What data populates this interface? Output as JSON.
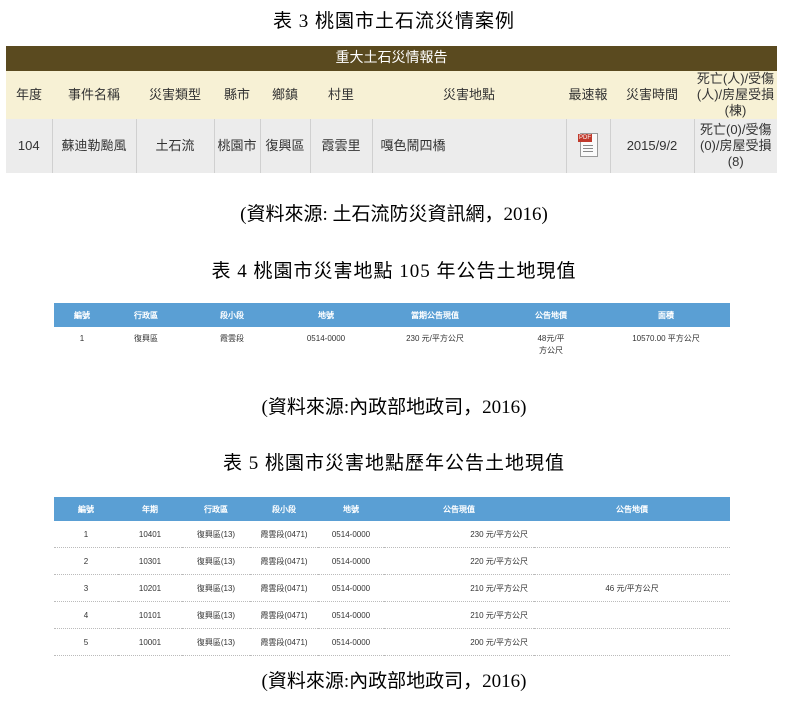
{
  "table3": {
    "caption": "表 3 桃園市土石流災情案例",
    "banner": "重大土石災情報告",
    "headers": [
      "年度",
      "事件名稱",
      "災害類型",
      "縣市",
      "鄉鎮",
      "村里",
      "災害地點",
      "最速報",
      "災害時間",
      "死亡(人)/受傷(人)/房屋受損(棟)"
    ],
    "row": {
      "year": "104",
      "event": "蘇迪勒颱風",
      "type": "土石流",
      "city": "桃園市",
      "town": "復興區",
      "village": "霞雲里",
      "location": "嘎色鬧四橋",
      "report_icon": "pdf-icon",
      "time": "2015/9/2",
      "casualties": "死亡(0)/受傷(0)/房屋受損(8)"
    },
    "source": "(資料來源: 土石流防災資訊網，2016)"
  },
  "table4": {
    "caption": "表 4 桃園市災害地點 105 年公告土地現值",
    "headers": [
      "編號",
      "行政區",
      "段小段",
      "地號",
      "當期公告現值",
      "公告地價",
      "面積"
    ],
    "row": {
      "no": "1",
      "district": "復興區",
      "section": "霞雲段",
      "lot": "0514-0000",
      "current_value": "230 元/平方公尺",
      "land_price": "48元/平方公尺",
      "area": "10570.00 平方公尺"
    },
    "source": "(資料來源:內政部地政司，2016)"
  },
  "table5": {
    "caption": "表 5 桃園市災害地點歷年公告土地現值",
    "headers": [
      "編號",
      "年期",
      "行政區",
      "段小段",
      "地號",
      "公告現值",
      "公告地價"
    ],
    "rows": [
      {
        "no": "1",
        "period": "10401",
        "district": "復興區(13)",
        "section": "霞雲段(0471)",
        "lot": "0514-0000",
        "value": "230 元/平方公尺",
        "price": ""
      },
      {
        "no": "2",
        "period": "10301",
        "district": "復興區(13)",
        "section": "霞雲段(0471)",
        "lot": "0514-0000",
        "value": "220 元/平方公尺",
        "price": ""
      },
      {
        "no": "3",
        "period": "10201",
        "district": "復興區(13)",
        "section": "霞雲段(0471)",
        "lot": "0514-0000",
        "value": "210 元/平方公尺",
        "price": "46 元/平方公尺"
      },
      {
        "no": "4",
        "period": "10101",
        "district": "復興區(13)",
        "section": "霞雲段(0471)",
        "lot": "0514-0000",
        "value": "210 元/平方公尺",
        "price": ""
      },
      {
        "no": "5",
        "period": "10001",
        "district": "復興區(13)",
        "section": "霞雲段(0471)",
        "lot": "0514-0000",
        "value": "200 元/平方公尺",
        "price": ""
      }
    ],
    "source": "(資料來源:內政部地政司，2016)"
  }
}
